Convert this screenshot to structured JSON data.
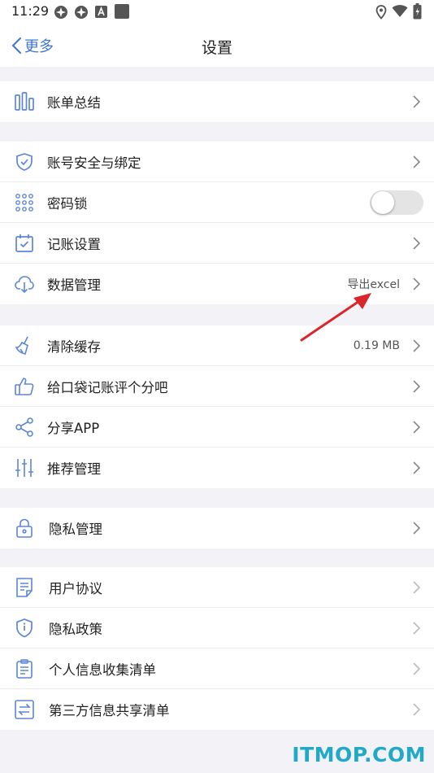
{
  "status_bar": {
    "time": "11:29"
  },
  "nav": {
    "back_label": "更多",
    "title": "设置"
  },
  "group1": [
    {
      "label": "账单总结",
      "icon": "bar-chart-icon"
    }
  ],
  "group2": [
    {
      "label": "账号安全与绑定",
      "icon": "shield-check-icon"
    },
    {
      "label": "密码锁",
      "icon": "keypad-icon",
      "toggle": false
    },
    {
      "label": "记账设置",
      "icon": "calendar-check-icon"
    },
    {
      "label": "数据管理",
      "icon": "cloud-download-icon",
      "value": "导出excel"
    }
  ],
  "group3": [
    {
      "label": "清除缓存",
      "icon": "broom-icon",
      "value": "0.19 MB"
    },
    {
      "label": "给口袋记账评个分吧",
      "icon": "thumbs-up-icon"
    },
    {
      "label": "分享APP",
      "icon": "share-icon"
    },
    {
      "label": "推荐管理",
      "icon": "sliders-icon"
    }
  ],
  "group4": [
    {
      "label": "隐私管理",
      "icon": "lock-icon"
    }
  ],
  "group5": [
    {
      "label": "用户协议",
      "icon": "document-icon"
    },
    {
      "label": "隐私政策",
      "icon": "shield-info-icon"
    },
    {
      "label": "个人信息收集清单",
      "icon": "clipboard-icon"
    },
    {
      "label": "第三方信息共享清单",
      "icon": "exchange-icon"
    }
  ],
  "watermark": "ITMOP.COM",
  "colors": {
    "accent": "#3f74d6",
    "icon": "#5b86d9",
    "annotation_arrow": "#d9262a",
    "background": "#f3f3f7"
  }
}
